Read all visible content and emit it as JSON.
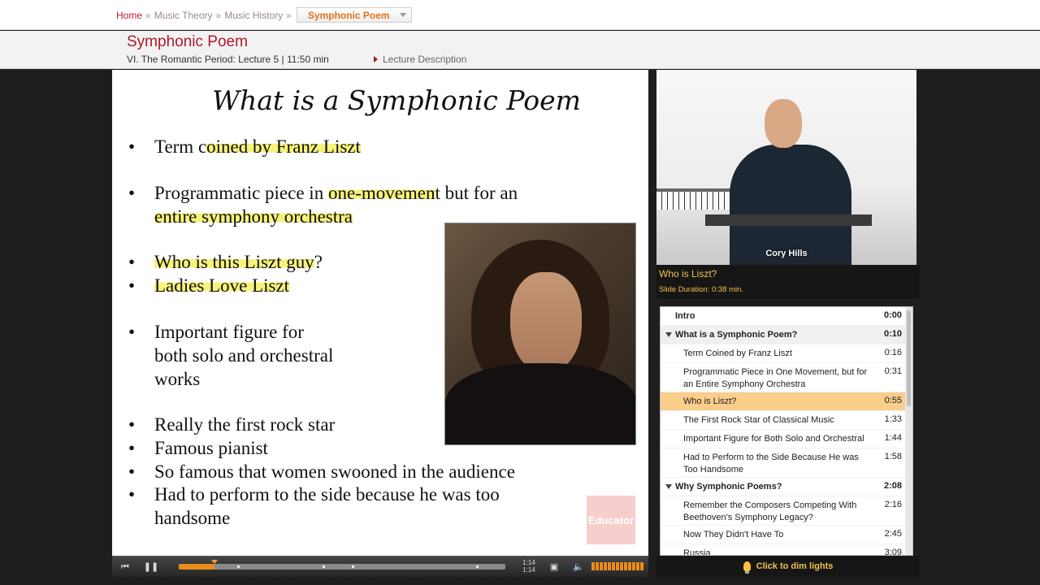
{
  "breadcrumb": {
    "home": "Home",
    "sep": "»",
    "items": [
      "Music Theory",
      "Music History"
    ],
    "current": "Symphonic Poem"
  },
  "lecture": {
    "title": "Symphonic Poem",
    "meta": "VI. The Romantic Period: Lecture 5 | 11:50 min",
    "description_link": "Lecture Description"
  },
  "slide": {
    "title": "What is a Symphonic Poem",
    "bullet_char": "•",
    "bullets": [
      {
        "pre": "Term c",
        "hl": "oined by Franz Liszt",
        "post": ""
      },
      {
        "pre": "Programmatic piece in ",
        "hl": "one-movemen",
        "post": "t but for an"
      },
      {
        "pre": "",
        "hl": "entire symphony orchestra",
        "post": ""
      },
      {
        "pre": "",
        "hl": "Who is this Liszt guy",
        "post": "?"
      },
      {
        "pre": "",
        "hl": "Ladies Love Liszt",
        "post": ""
      },
      {
        "pre": "Important figure for",
        "hl": "",
        "post": ""
      },
      {
        "pre": "both solo and orchestral",
        "hl": "",
        "post": ""
      },
      {
        "pre": "works",
        "hl": "",
        "post": ""
      },
      {
        "pre": "Really the first rock star",
        "hl": "",
        "post": ""
      },
      {
        "pre": "Famous pianist",
        "hl": "",
        "post": ""
      },
      {
        "pre": "So famous that women swooned in the audience",
        "hl": "",
        "post": ""
      },
      {
        "pre": "Had to perform to the side because he was too",
        "hl": "",
        "post": ""
      },
      {
        "pre": "handsome",
        "hl": "",
        "post": ""
      }
    ],
    "watermark": "Educator"
  },
  "player": {
    "progress_fraction": 0.11,
    "chapter_marks": [
      0.18,
      0.44,
      0.53,
      0.91
    ],
    "time_current": "1:14",
    "time_total": "1:14",
    "prev_icon": "skip-back-icon",
    "pause_icon": "pause-icon",
    "fullscreen_icon": "fullscreen-icon",
    "volume_icon": "speaker-icon",
    "accent": "#e98b1a"
  },
  "video": {
    "speaker": "Cory Hills"
  },
  "current_slide": {
    "title": "Who is Liszt?",
    "duration": "Slide Duration: 0:38 min."
  },
  "toc": [
    {
      "label": "Intro",
      "time": "0:00",
      "type": "section"
    },
    {
      "label": "What is a Symphonic Poem?",
      "time": "0:10",
      "type": "section-open"
    },
    {
      "label": "Term Coined by Franz Liszt",
      "time": "0:16",
      "type": "item"
    },
    {
      "label": "Programmatic Piece in One Movement, but for an Entire Symphony Orchestra",
      "time": "0:31",
      "type": "item"
    },
    {
      "label": "Who is Liszt?",
      "time": "0:55",
      "type": "active"
    },
    {
      "label": "The First Rock Star of Classical Music",
      "time": "1:33",
      "type": "item"
    },
    {
      "label": "Important Figure for Both Solo and Orchestral",
      "time": "1:44",
      "type": "item"
    },
    {
      "label": "Had to Perform to the Side Because He was Too Handsome",
      "time": "1:58",
      "type": "item"
    },
    {
      "label": "Why Symphonic Poems?",
      "time": "2:08",
      "type": "section-open"
    },
    {
      "label": "Remember the Composers Competing With Beethoven's Symphony Legacy?",
      "time": "2:16",
      "type": "item"
    },
    {
      "label": "Now They Didn't Have To",
      "time": "2:45",
      "type": "item"
    },
    {
      "label": "Russia",
      "time": "3:09",
      "type": "item"
    }
  ],
  "dim_lights": "Click to dim lights"
}
